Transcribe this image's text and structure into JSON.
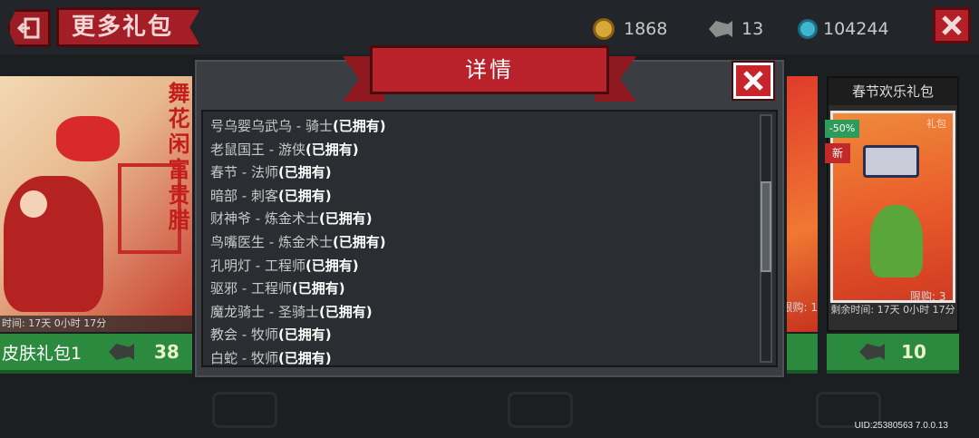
{
  "header": {
    "title": "更多礼包",
    "coins": "1868",
    "fish": "13",
    "gems": "104244"
  },
  "left_card": {
    "banner": "舞花闲富贵腊",
    "timer": "时间: 17天 0小时 17分",
    "name": "皮肤礼包1",
    "price": "38"
  },
  "right_card": {
    "title": "春节欢乐礼包",
    "discount": "-50%",
    "new_tag": "新",
    "gift_mark": "礼包",
    "limit": "限购: 3",
    "timer": "剩余时间: 17天 0小时 17分",
    "price": "10"
  },
  "peek_card": {
    "text": "限购: 1"
  },
  "modal": {
    "title": "详情",
    "items": [
      {
        "hero": "号乌婴乌武乌 - 骑士",
        "status": "(已拥有)"
      },
      {
        "hero": "老鼠国王 - 游侠",
        "status": "(已拥有)"
      },
      {
        "hero": "春节 - 法师",
        "status": "(已拥有)"
      },
      {
        "hero": "暗部 - 刺客",
        "status": "(已拥有)"
      },
      {
        "hero": "财神爷 - 炼金术士",
        "status": "(已拥有)"
      },
      {
        "hero": "鸟嘴医生 - 炼金术士",
        "status": "(已拥有)"
      },
      {
        "hero": "孔明灯 - 工程师",
        "status": "(已拥有)"
      },
      {
        "hero": "驱邪 - 工程师",
        "status": "(已拥有)"
      },
      {
        "hero": "魔龙骑士 - 圣骑士",
        "status": "(已拥有)"
      },
      {
        "hero": "教会 - 牧师",
        "status": "(已拥有)"
      },
      {
        "hero": "白蛇 - 牧师",
        "status": "(已拥有)"
      }
    ]
  },
  "footer": {
    "uid": "UID:25380563 7.0.0.13"
  },
  "icons": {
    "back": "exit-icon",
    "coin": "coin-icon",
    "fish": "fish-icon",
    "gem": "gem-icon",
    "close": "close-icon"
  },
  "colors": {
    "accent_red": "#b9222b",
    "buy_green": "#2b8a3e",
    "modal_bg": "#3a3d42",
    "list_bg": "#2a2d31"
  }
}
